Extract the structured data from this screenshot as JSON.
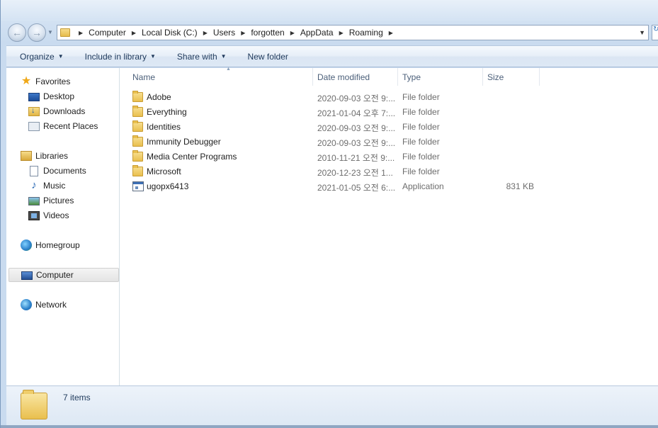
{
  "address_bar": {
    "crumbs": [
      "Computer",
      "Local Disk (C:)",
      "Users",
      "forgotten",
      "AppData",
      "Roaming"
    ]
  },
  "command_bar": {
    "organize": "Organize",
    "include_in_library": "Include in library",
    "share_with": "Share with",
    "new_folder": "New folder"
  },
  "nav_pane": {
    "favorites": "Favorites",
    "desktop": "Desktop",
    "downloads": "Downloads",
    "recent_places": "Recent Places",
    "libraries": "Libraries",
    "documents": "Documents",
    "music": "Music",
    "pictures": "Pictures",
    "videos": "Videos",
    "homegroup": "Homegroup",
    "computer": "Computer",
    "network": "Network"
  },
  "columns": {
    "name": "Name",
    "date_modified": "Date modified",
    "type": "Type",
    "size": "Size"
  },
  "files": [
    {
      "name": "Adobe",
      "date": "2020-09-03 오전 9:...",
      "type": "File folder",
      "size": "",
      "icon": "folder-icon"
    },
    {
      "name": "Everything",
      "date": "2021-01-04 오후 7:...",
      "type": "File folder",
      "size": "",
      "icon": "folder-icon"
    },
    {
      "name": "Identities",
      "date": "2020-09-03 오전 9:...",
      "type": "File folder",
      "size": "",
      "icon": "folder-icon"
    },
    {
      "name": "Immunity Debugger",
      "date": "2020-09-03 오전 9:...",
      "type": "File folder",
      "size": "",
      "icon": "folder-icon"
    },
    {
      "name": "Media Center Programs",
      "date": "2010-11-21 오전 9:...",
      "type": "File folder",
      "size": "",
      "icon": "folder-icon"
    },
    {
      "name": "Microsoft",
      "date": "2020-12-23 오전 1...",
      "type": "File folder",
      "size": "",
      "icon": "folder-icon"
    },
    {
      "name": "ugopx6413",
      "date": "2021-01-05 오전 6:...",
      "type": "Application",
      "size": "831 KB",
      "icon": "application-icon"
    }
  ],
  "details_pane": {
    "item_count": "7 items"
  }
}
